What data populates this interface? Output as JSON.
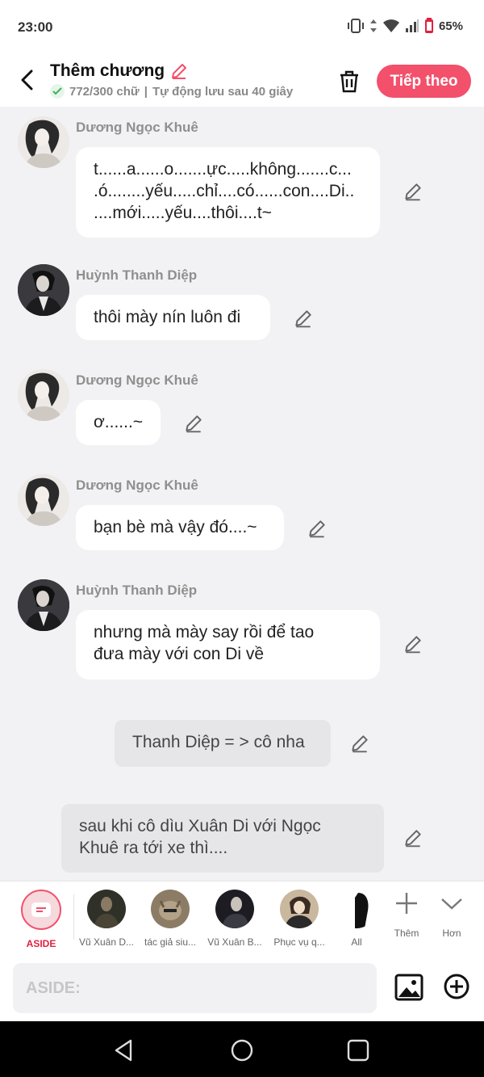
{
  "status": {
    "time": "23:00",
    "battery": "65%"
  },
  "header": {
    "title": "Thêm chương",
    "word_count": "772/300 chữ",
    "separator": "|",
    "autosave": "Tự động lưu sau 40 giây",
    "next_label": "Tiếp theo"
  },
  "messages": [
    {
      "sender": "Dương Ngọc Khuê",
      "lines": [
        "t......a......o.......ực.....không.......c...",
        ".ó........yếu.....chỉ....có......con....Di..",
        "....mới.....yếu....thôi....t~"
      ]
    },
    {
      "sender": "Huỳnh Thanh Diệp",
      "lines": [
        "thôi mày nín luôn đi"
      ]
    },
    {
      "sender": "Dương Ngọc Khuê",
      "lines": [
        "ơ......~"
      ]
    },
    {
      "sender": "Dương Ngọc Khuê",
      "lines": [
        "bạn bè mà vậy đó....~"
      ]
    },
    {
      "sender": "Huỳnh Thanh Diệp",
      "lines": [
        "nhưng mà mày say rồi để tao",
        "đưa mày với con Di về"
      ]
    }
  ],
  "asides": [
    {
      "lines": [
        "Thanh Diệp = > cô nha"
      ]
    },
    {
      "lines": [
        "sau khi cô dìu Xuân Di với Ngọc",
        "Khuê ra tới xe thì...."
      ]
    }
  ],
  "toolbar": {
    "aside_label": "ASIDE",
    "characters": [
      "Vũ Xuân D...",
      "tác giả siu...",
      "Vũ Xuân B...",
      "Phục vụ q...",
      "All"
    ],
    "add_label": "Thêm",
    "more_label": "Hơn"
  },
  "input": {
    "placeholder": "ASIDE:"
  },
  "colors": {
    "accent": "#f2506b",
    "aside_red": "#e0213f",
    "chat_bg": "#f2f2f4"
  }
}
